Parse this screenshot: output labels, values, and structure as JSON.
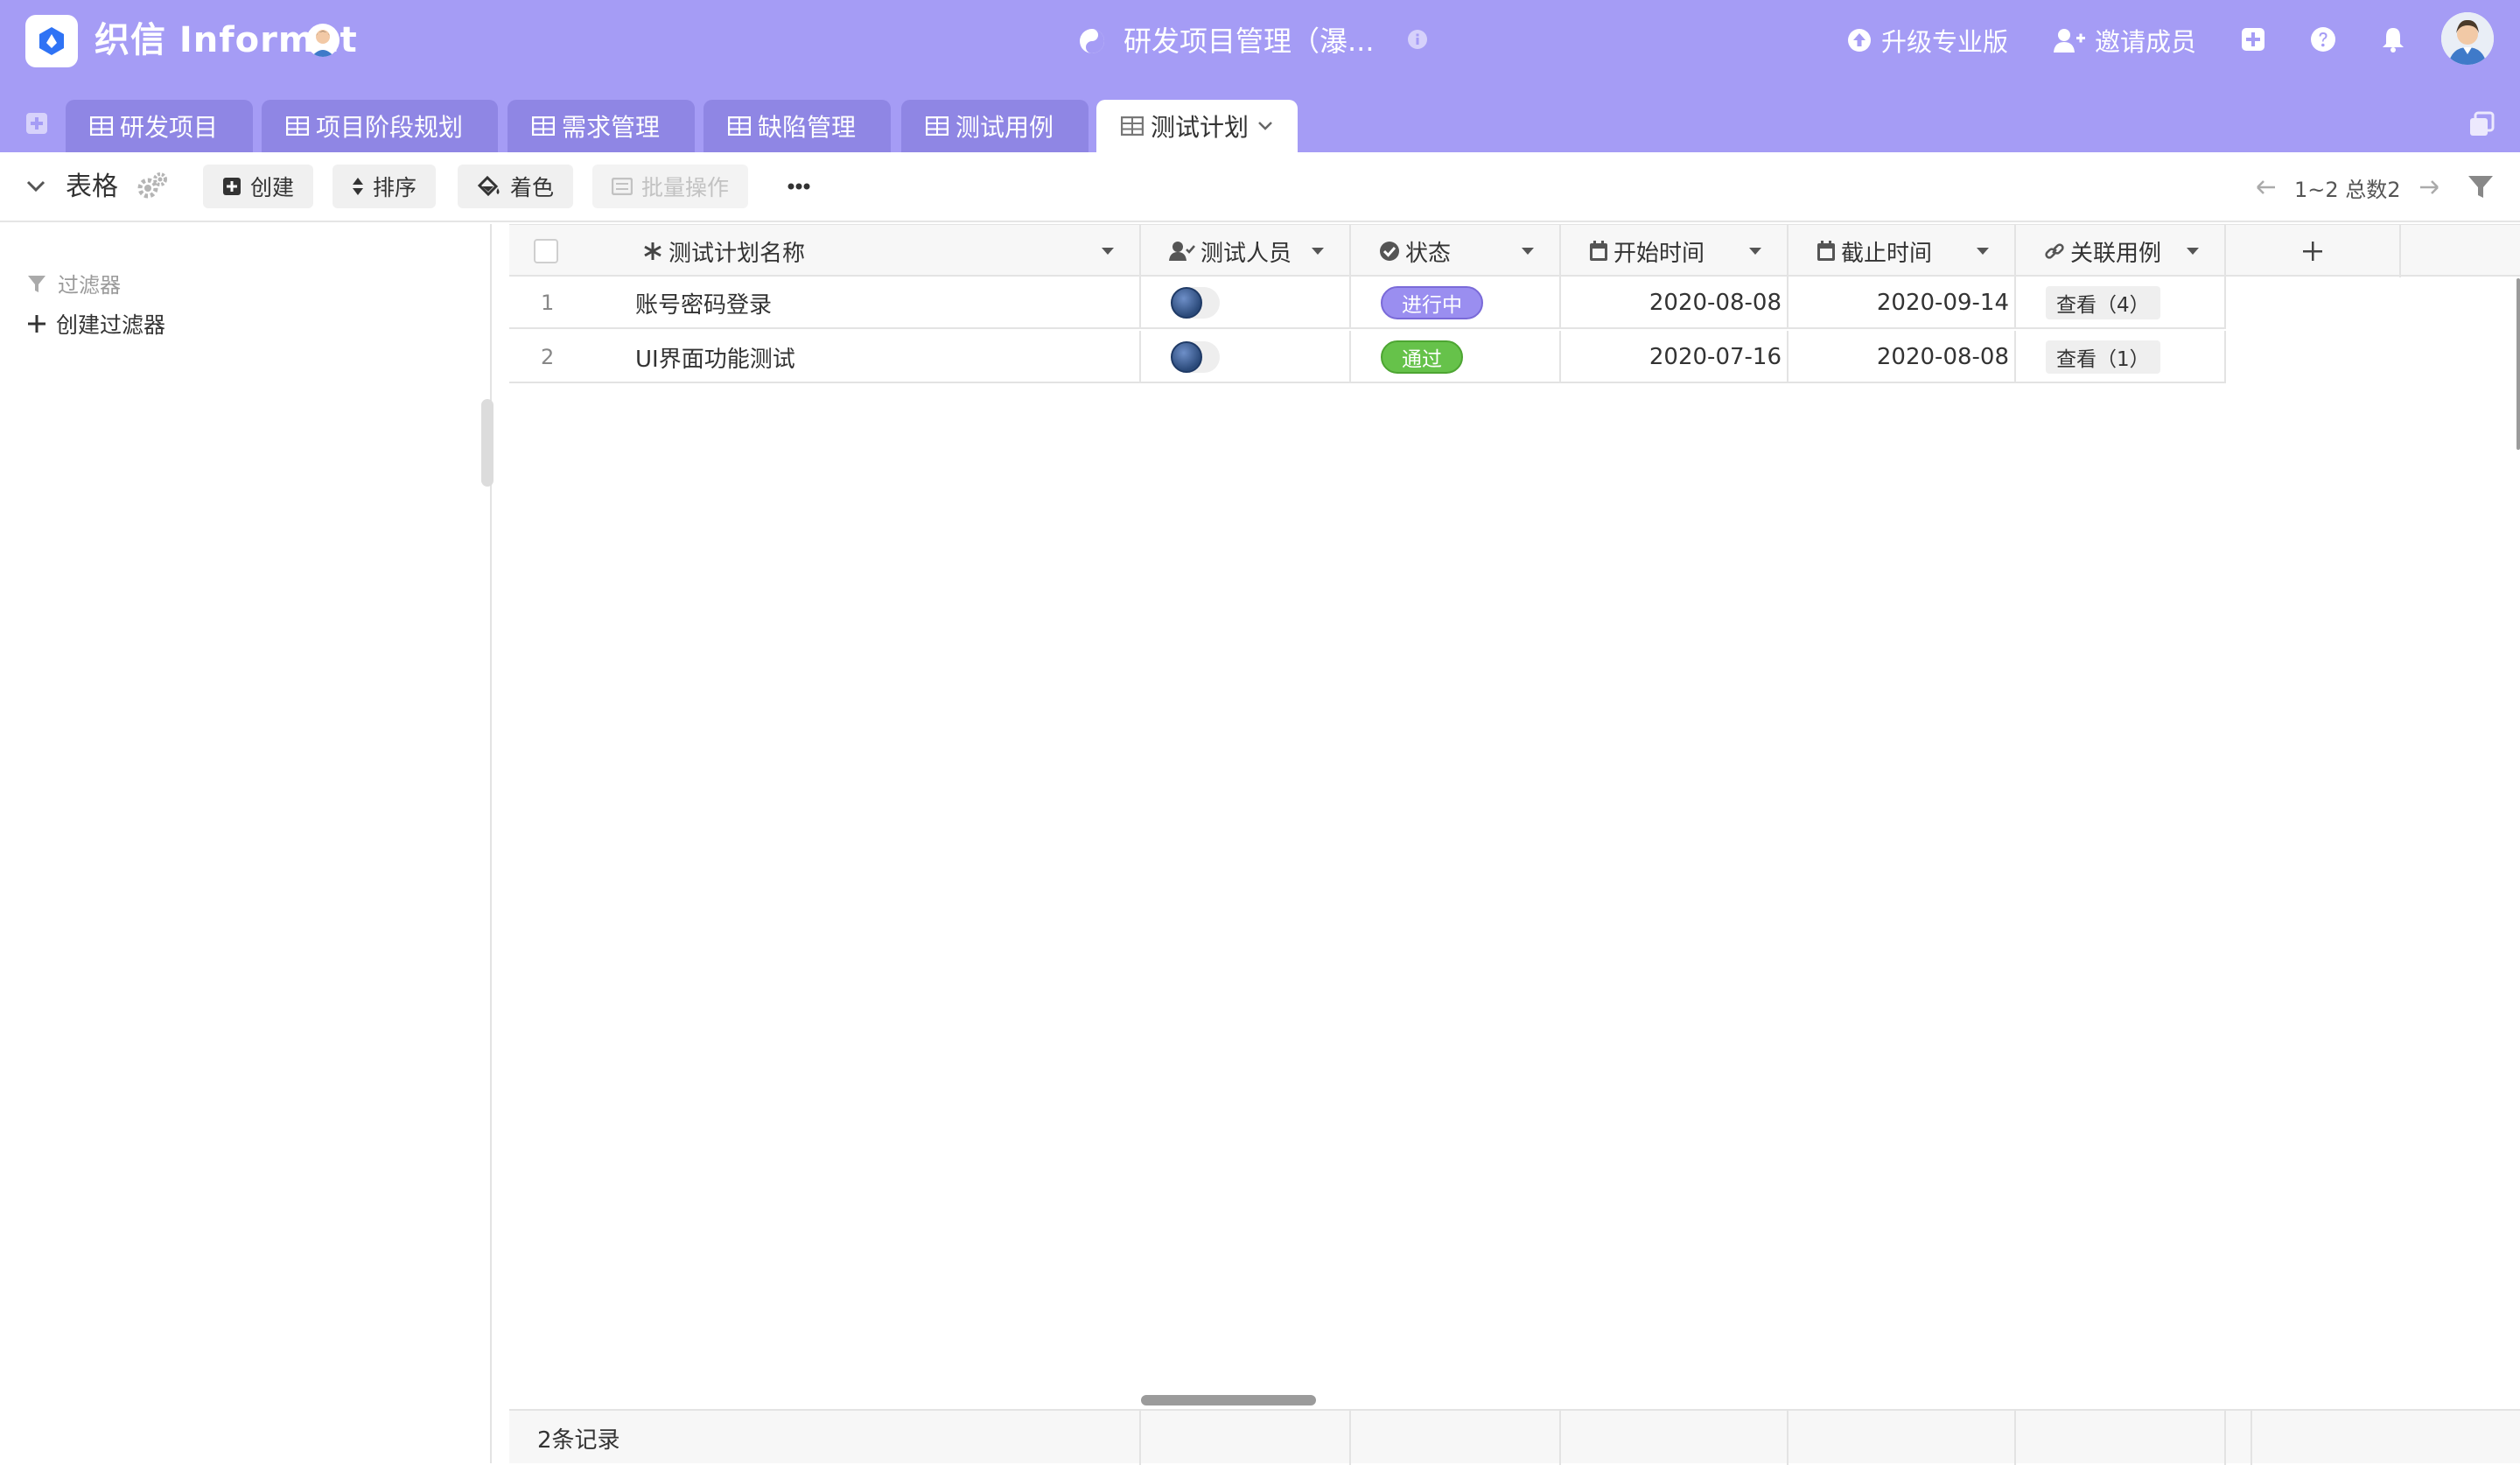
{
  "app": {
    "brand": "织信 Informat"
  },
  "header": {
    "doc_title": "研发项目管理（瀑...",
    "actions": {
      "upgrade": "升级专业版",
      "invite": "邀请成员"
    }
  },
  "tabs": [
    {
      "label": "研发项目"
    },
    {
      "label": "项目阶段规划"
    },
    {
      "label": "需求管理"
    },
    {
      "label": "缺陷管理"
    },
    {
      "label": "测试用例"
    },
    {
      "label": "测试计划",
      "active": true
    }
  ],
  "toolbar": {
    "view_name": "表格",
    "create": "创建",
    "sort": "排序",
    "color": "着色",
    "batch": "批量操作",
    "pager": "1~2 总数2"
  },
  "sidebar": {
    "filter_title": "过滤器",
    "create_filter": "创建过滤器"
  },
  "grid": {
    "columns": [
      {
        "label": "测试计划名称",
        "icon": "asterisk-icon"
      },
      {
        "label": "测试人员",
        "icon": "user-check-icon"
      },
      {
        "label": "状态",
        "icon": "check-circle-icon"
      },
      {
        "label": "开始时间",
        "icon": "calendar-icon"
      },
      {
        "label": "截止时间",
        "icon": "calendar-icon"
      },
      {
        "label": "关联用例",
        "icon": "link-icon"
      }
    ],
    "rows": [
      {
        "num": "1",
        "name": "账号密码登录",
        "status": "进行中",
        "status_color": "#9a8ef0",
        "start": "2020-08-08",
        "end": "2020-09-14",
        "linked": "查看（4）"
      },
      {
        "num": "2",
        "name": "UI界面功能测试",
        "status": "通过",
        "status_color": "#66c24a",
        "start": "2020-07-16",
        "end": "2020-08-08",
        "linked": "查看（1）"
      }
    ],
    "footer": "2条记录"
  },
  "colors": {
    "header_bg": "#a59cf5",
    "tab_bg": "#8f86e4",
    "accent": "#3a6ff7"
  }
}
